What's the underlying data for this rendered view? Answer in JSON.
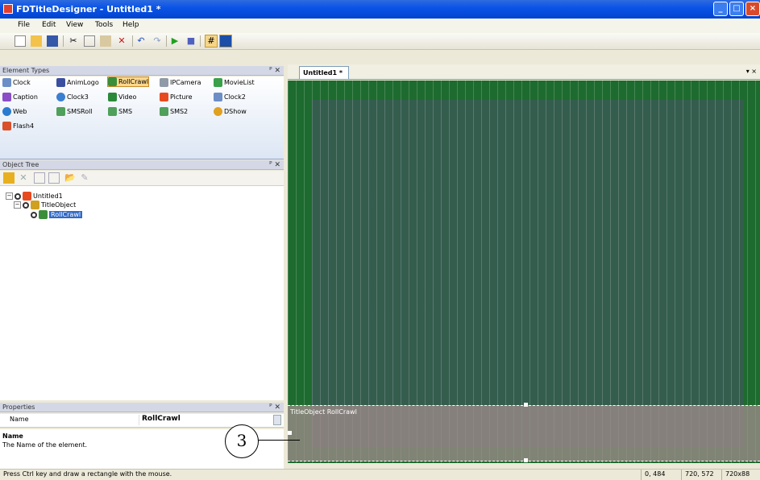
{
  "window": {
    "title": "FDTitleDesigner - Untitled1 *"
  },
  "menu": [
    "File",
    "Edit",
    "View",
    "Tools",
    "Help"
  ],
  "toolbar": {
    "icons": [
      "new-icon",
      "open-icon",
      "save-icon",
      "cut-icon",
      "copy-icon",
      "paste-icon",
      "delete-icon",
      "undo-icon",
      "redo-icon",
      "play-icon",
      "stop-icon",
      "grid-icon",
      "safe-area-icon"
    ]
  },
  "element_types": {
    "title": "Element Types",
    "pin": "📌",
    "close": "✕",
    "items": [
      "Clock",
      "AnimLogo",
      "RollCrawl",
      "IPCamera",
      "MovieList",
      "Caption",
      "Clock3",
      "Video",
      "Picture",
      "Clock2",
      "Web",
      "SMSRoll",
      "SMS",
      "SMS2",
      "DShow",
      "Flash4"
    ],
    "selected": "RollCrawl"
  },
  "object_tree": {
    "title": "Object Tree",
    "nodes": [
      "Untitled1",
      "TitleObject",
      "RollCrawl"
    ]
  },
  "properties": {
    "title": "Properties",
    "row_name": "Name",
    "row_value": "RollCrawl",
    "desc_title": "Name",
    "desc_text": "The Name of the element."
  },
  "document": {
    "tab": "Untitled1 *",
    "crawl_label": "TitleObject RollCrawl"
  },
  "callout": "3",
  "status": {
    "hint": "Press Ctrl key and draw a rectangle with the mouse.",
    "coords": "0, 484",
    "size1": "720, 572",
    "size2": "720x88"
  }
}
